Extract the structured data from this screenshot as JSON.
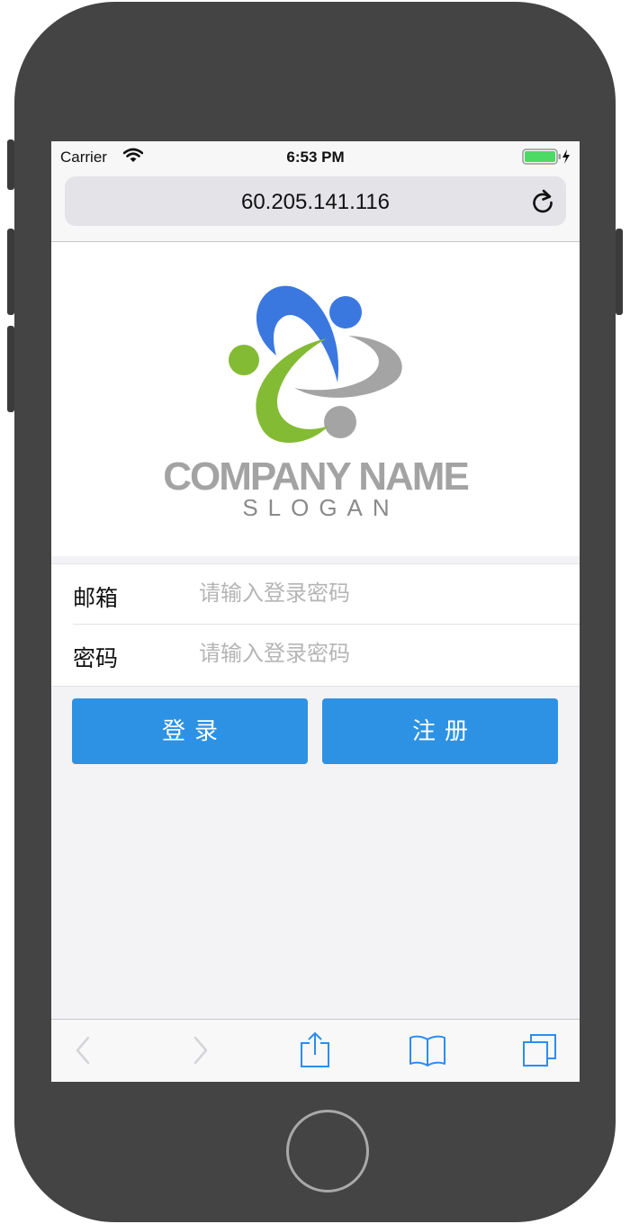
{
  "status_bar": {
    "carrier": "Carrier",
    "time": "6:53 PM"
  },
  "browser": {
    "url": "60.205.141.116"
  },
  "logo": {
    "company_name": "COMPANY NAME",
    "slogan": "SLOGAN",
    "colors": {
      "blue": "#3a78e0",
      "green": "#84bb35",
      "gray": "#a4a4a4"
    }
  },
  "form": {
    "email_label": "邮箱",
    "email_placeholder": "请输入登录密码",
    "password_label": "密码",
    "password_placeholder": "请输入登录密码"
  },
  "buttons": {
    "login_label": "登录",
    "register_label": "注册",
    "color": "#2d92e4"
  },
  "toolbar": {
    "icons": [
      "back-icon",
      "forward-icon",
      "share-icon",
      "bookmarks-icon",
      "tabs-icon"
    ],
    "accent": "#2d8cf0"
  }
}
